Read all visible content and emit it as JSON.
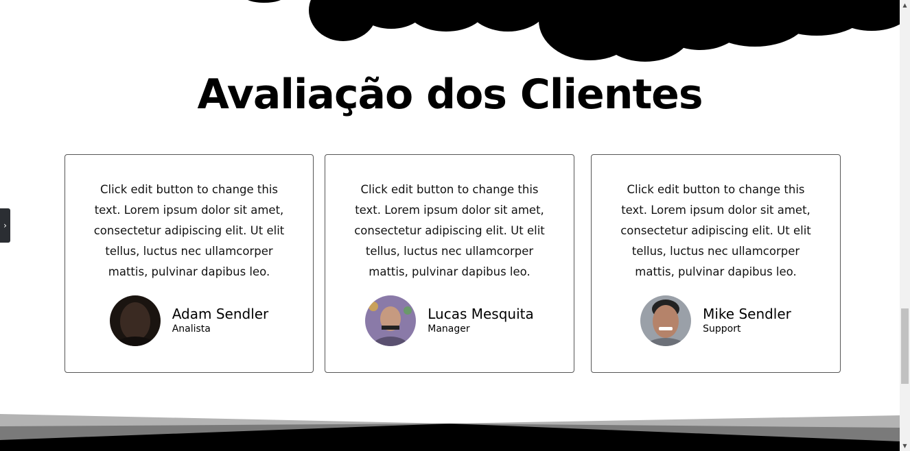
{
  "section": {
    "title": "Avaliação dos Clientes"
  },
  "testimonials": [
    {
      "text": "Click edit button to change this text. Lorem ipsum dolor sit amet, consectetur adipiscing elit. Ut elit tellus, luctus nec ullamcorper mattis, pulvinar dapibus leo.",
      "name": "Adam Sendler",
      "role": "Analista",
      "avatar_tone": "#3a2a22"
    },
    {
      "text": "Click edit button to change this text. Lorem ipsum dolor sit amet, consectetur adipiscing elit. Ut elit tellus, luctus nec ullamcorper mattis, pulvinar dapibus leo.",
      "name": "Lucas Mesquita",
      "role": "Manager",
      "avatar_tone": "#8a7aa8"
    },
    {
      "text": "Click edit button to change this text. Lorem ipsum dolor sit amet, consectetur adipiscing elit. Ut elit tellus, luctus nec ullamcorper mattis, pulvinar dapibus leo.",
      "name": "Mike Sendler",
      "role": "Support",
      "avatar_tone": "#b5836a"
    }
  ],
  "side_tab": {
    "icon": "chevron-right-icon",
    "glyph": "›"
  },
  "scrollbar": {
    "up_glyph": "▲",
    "down_glyph": "▼"
  },
  "colors": {
    "background": "#ffffff",
    "text": "#000000",
    "card_border": "#555555",
    "divider_dark": "#000000",
    "divider_mid": "#7a7a7a",
    "divider_light": "#b3b3b3"
  }
}
